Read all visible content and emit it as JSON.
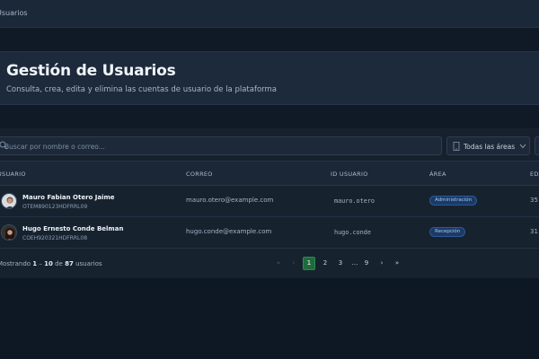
{
  "breadcrumb": "Usuarios",
  "header": {
    "title": "Gestión de Usuarios",
    "subtitle": "Consulta, crea, edita y elimina las cuentas de usuario de la plataforma"
  },
  "filters": {
    "search_placeholder": "Buscar por nombre o correo...",
    "area_select": "Todas las áreas"
  },
  "table": {
    "columns": [
      "USUARIO",
      "CORREO",
      "ID USUARIO",
      "ÁREA",
      "EDAD"
    ],
    "rows": [
      {
        "name": "Mauro Fabian Otero Jaime",
        "code": "OTEM890123HDFRRL09",
        "email": "mauro.otero@example.com",
        "user_id": "mauro.otero",
        "area": "Administración",
        "age": "35"
      },
      {
        "name": "Hugo Ernesto Conde Belman",
        "code": "COEH920321HDFRRL08",
        "email": "hugo.conde@example.com",
        "user_id": "hugo.conde",
        "area": "Recepción",
        "age": "31"
      }
    ]
  },
  "footer": {
    "prefix": "Mostrando",
    "range_start": "1",
    "range_sep": "–",
    "range_end": "10",
    "of": "de",
    "total": "87",
    "suffix": "usuarios"
  },
  "pagination": {
    "first": "«",
    "prev": "‹",
    "pages": [
      "1",
      "2",
      "3"
    ],
    "ellipsis": "...",
    "last_page": "9",
    "next": "›",
    "last": "»",
    "current": "1"
  },
  "colors": {
    "accent": "#1f6b3c",
    "badge_bg": "#1b3a66",
    "badge_text": "#a9c8f2"
  }
}
